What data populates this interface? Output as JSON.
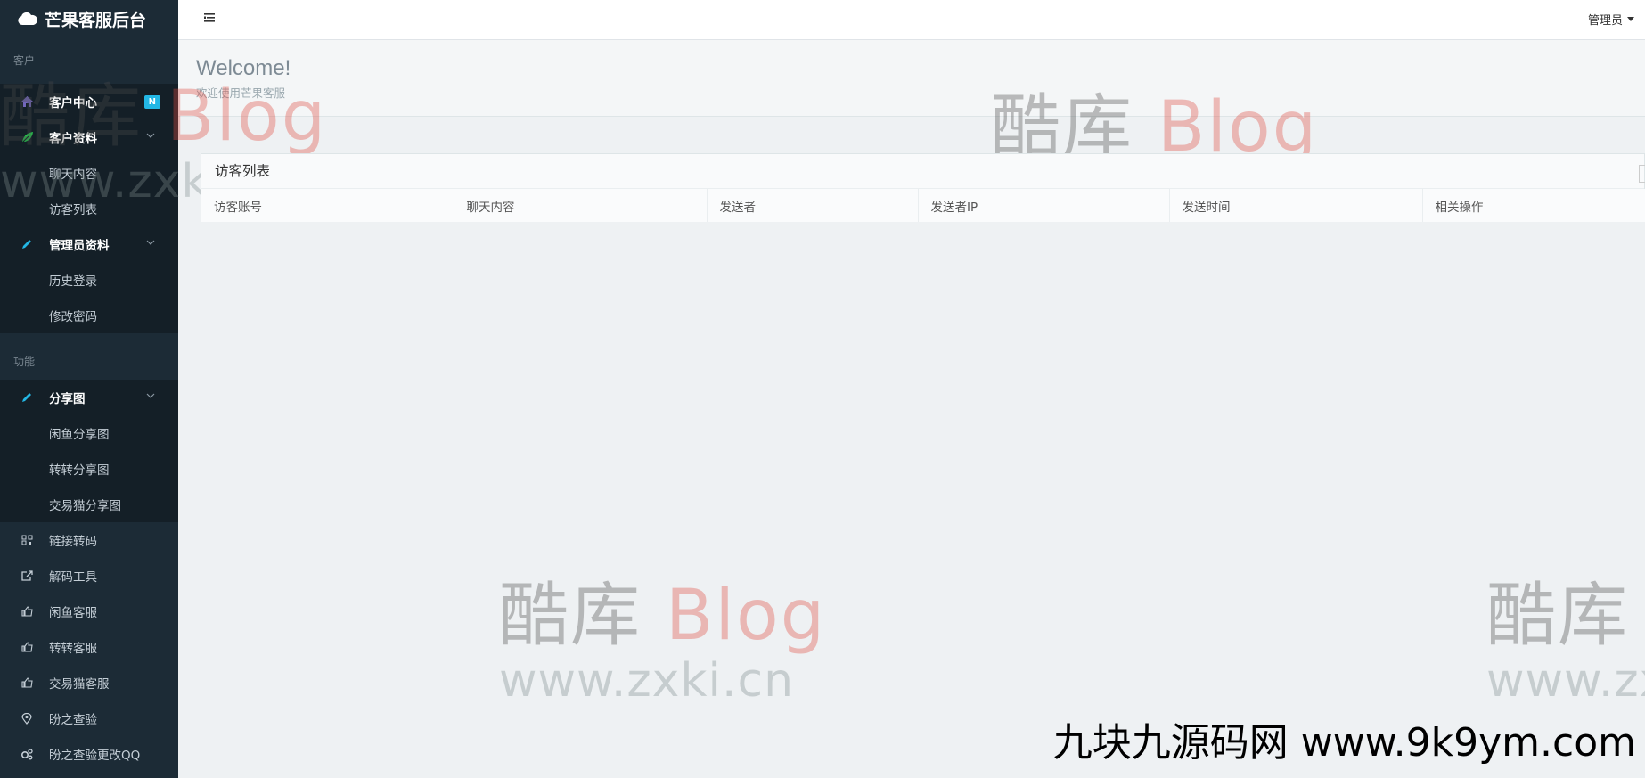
{
  "brand": {
    "title": "芒果客服后台",
    "icon": "cloud-icon"
  },
  "sidebar": {
    "section_customer": "客户",
    "customer_center": {
      "label": "客户中心",
      "badge": "N"
    },
    "customer_info": {
      "label": "客户资料",
      "children": [
        "聊天内容",
        "访客列表"
      ]
    },
    "admin_info": {
      "label": "管理员资料",
      "children": [
        "历史登录",
        "修改密码"
      ]
    },
    "section_function": "功能",
    "share_image": {
      "label": "分享图",
      "children": [
        "闲鱼分享图",
        "转转分享图",
        "交易猫分享图"
      ]
    },
    "items": [
      "链接转码",
      "解码工具",
      "闲鱼客服",
      "转转客服",
      "交易猫客服",
      "盼之查验",
      "盼之查验更改QQ"
    ]
  },
  "topbar": {
    "user": "管理员"
  },
  "header": {
    "title": "Welcome!",
    "subtitle": "欢迎使用芒果客服"
  },
  "panel": {
    "title": "访客列表",
    "columns": [
      "访客账号",
      "聊天内容",
      "发送者",
      "发送者IP",
      "发送时间",
      "相关操作"
    ]
  },
  "watermark": {
    "cn": "酷库",
    "blog": "Blog",
    "url": "www.zxki.cn",
    "site": "九块九源码网 www.9k9ym.com"
  },
  "colors": {
    "sidebar_bg": "#1c2b36",
    "sidebar_sub_bg": "#141f27",
    "badge": "#23b7e5",
    "content_bg": "#eef1f3"
  }
}
